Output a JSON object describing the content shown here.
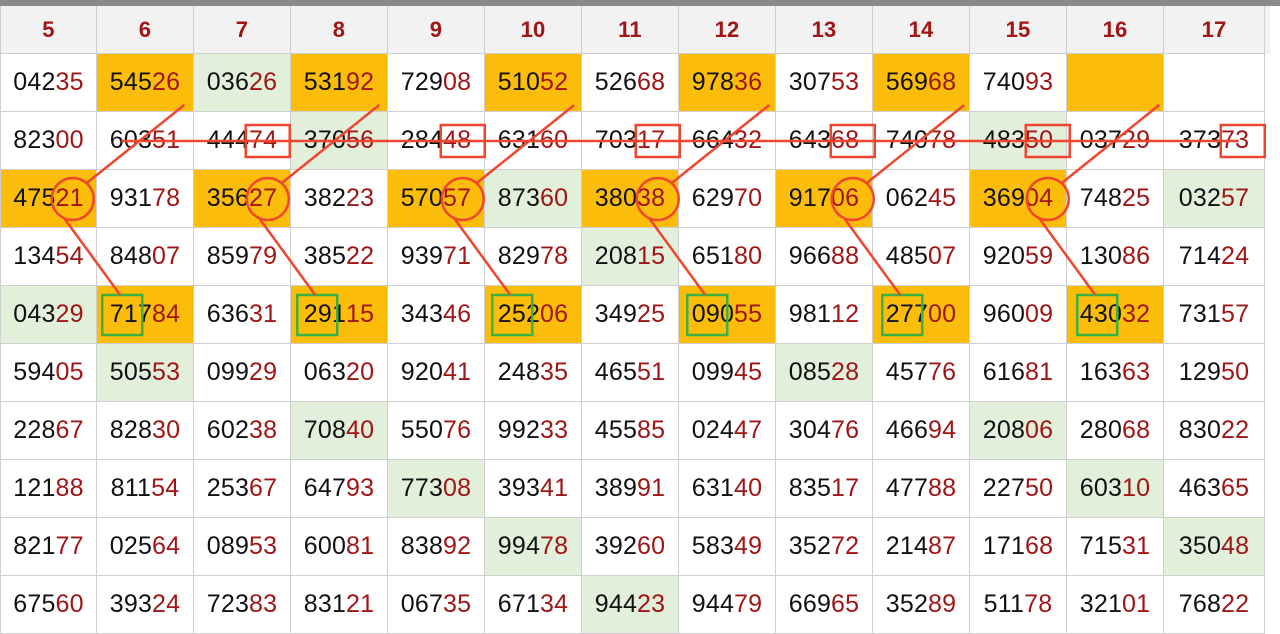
{
  "columns": [
    "5",
    "6",
    "7",
    "8",
    "9",
    "10",
    "11",
    "12",
    "13",
    "14",
    "15",
    "16",
    "17"
  ],
  "rows": [
    [
      "04235",
      "54526",
      "03626",
      "53192",
      "72908",
      "51052",
      "52668",
      "97836",
      "30753",
      "56968",
      "74093",
      "",
      ""
    ],
    [
      "82300",
      "60351",
      "44474",
      "37056",
      "28448",
      "63160",
      "70317",
      "66432",
      "64368",
      "74078",
      "48350",
      "03729",
      "37373"
    ],
    [
      "47521",
      "93178",
      "35627",
      "38223",
      "57057",
      "87360",
      "38038",
      "62970",
      "91706",
      "06245",
      "36904",
      "74825",
      "03257"
    ],
    [
      "13454",
      "84807",
      "85979",
      "38522",
      "93971",
      "82978",
      "20815",
      "65180",
      "96688",
      "48507",
      "92059",
      "13086",
      "71424"
    ],
    [
      "04329",
      "71784",
      "63631",
      "29115",
      "34346",
      "25206",
      "34925",
      "09055",
      "98112",
      "27700",
      "96009",
      "43032",
      "73157"
    ],
    [
      "59405",
      "50553",
      "09929",
      "06320",
      "92041",
      "24835",
      "46551",
      "09945",
      "08528",
      "45776",
      "61681",
      "16363",
      "12950"
    ],
    [
      "22867",
      "82830",
      "60238",
      "70840",
      "55076",
      "99233",
      "45585",
      "02447",
      "30476",
      "46694",
      "20806",
      "28068",
      "83022"
    ],
    [
      "12188",
      "81154",
      "25367",
      "64793",
      "77308",
      "39341",
      "38991",
      "63140",
      "83517",
      "47788",
      "22750",
      "60310",
      "46365"
    ],
    [
      "82177",
      "02564",
      "08953",
      "60081",
      "83892",
      "99478",
      "39260",
      "58349",
      "35272",
      "21487",
      "17168",
      "71531",
      "35048"
    ],
    [
      "67560",
      "39324",
      "72383",
      "83121",
      "06735",
      "67134",
      "94423",
      "94479",
      "66965",
      "35289",
      "51178",
      "32101",
      "76822"
    ]
  ],
  "highlight_cells": [
    [
      0,
      1
    ],
    [
      0,
      3
    ],
    [
      0,
      5
    ],
    [
      0,
      7
    ],
    [
      0,
      9
    ],
    [
      0,
      11
    ],
    [
      2,
      0
    ],
    [
      2,
      2
    ],
    [
      2,
      4
    ],
    [
      2,
      6
    ],
    [
      2,
      8
    ],
    [
      2,
      10
    ],
    [
      4,
      1
    ],
    [
      4,
      3
    ],
    [
      4,
      5
    ],
    [
      4,
      7
    ],
    [
      4,
      9
    ],
    [
      4,
      11
    ]
  ],
  "green_cells": [
    [
      0,
      2
    ],
    [
      1,
      3
    ],
    [
      1,
      10
    ],
    [
      2,
      5
    ],
    [
      2,
      12
    ],
    [
      3,
      6
    ],
    [
      4,
      0
    ],
    [
      5,
      1
    ],
    [
      5,
      8
    ],
    [
      6,
      3
    ],
    [
      6,
      10
    ],
    [
      7,
      4
    ],
    [
      7,
      11
    ],
    [
      8,
      5
    ],
    [
      8,
      12
    ],
    [
      9,
      6
    ]
  ],
  "circled_cells": [
    [
      2,
      0
    ],
    [
      2,
      2
    ],
    [
      2,
      4
    ],
    [
      2,
      6
    ],
    [
      2,
      8
    ],
    [
      2,
      10
    ]
  ],
  "boxed_red_cells": [
    [
      1,
      2
    ],
    [
      1,
      4
    ],
    [
      1,
      6
    ],
    [
      1,
      8
    ],
    [
      1,
      10
    ],
    [
      1,
      12
    ]
  ],
  "boxed_green_cells": [
    [
      4,
      1
    ],
    [
      4,
      3
    ],
    [
      4,
      5
    ],
    [
      4,
      7
    ],
    [
      4,
      9
    ],
    [
      4,
      11
    ]
  ],
  "colors": {
    "highlight": "#fbbd0a",
    "green": "#e2efda",
    "digit_tail": "#a01515",
    "header_text": "#a01515",
    "annotation_red": "#f0452e",
    "annotation_green": "#3cb043"
  }
}
